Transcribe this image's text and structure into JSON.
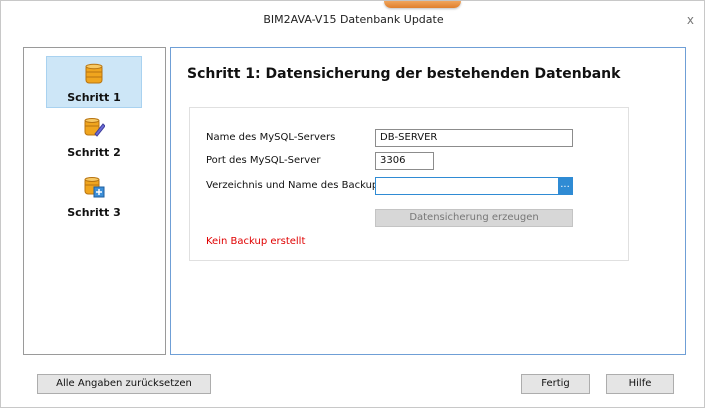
{
  "window": {
    "title": "BIM2AVA-V15 Datenbank Update",
    "close_glyph": "x"
  },
  "sidebar": {
    "steps": [
      {
        "label": "Schritt 1",
        "icon": "database-icon",
        "active": true
      },
      {
        "label": "Schritt 2",
        "icon": "database-edit-icon",
        "active": false
      },
      {
        "label": "Schritt 3",
        "icon": "database-update-icon",
        "active": false
      }
    ]
  },
  "main": {
    "heading": "Schritt 1: Datensicherung der bestehenden Datenbank",
    "fields": {
      "server": {
        "label": "Name des MySQL-Servers",
        "value": "DB-SERVER"
      },
      "port": {
        "label": "Port des MySQL-Server",
        "value": "3306"
      },
      "backup": {
        "label": "Verzeichnis und Name des Backup",
        "value": "",
        "browse": "..."
      }
    },
    "create_backup_button": "Datensicherung erzeugen",
    "status": "Kein Backup erstellt"
  },
  "footer": {
    "reset_button": "Alle Angaben zurücksetzen",
    "finish_button": "Fertig",
    "help_button": "Hilfe"
  },
  "colors": {
    "accent": "#2f8bd4",
    "active_step_bg": "#cde6f7",
    "status_red": "#e00000"
  }
}
